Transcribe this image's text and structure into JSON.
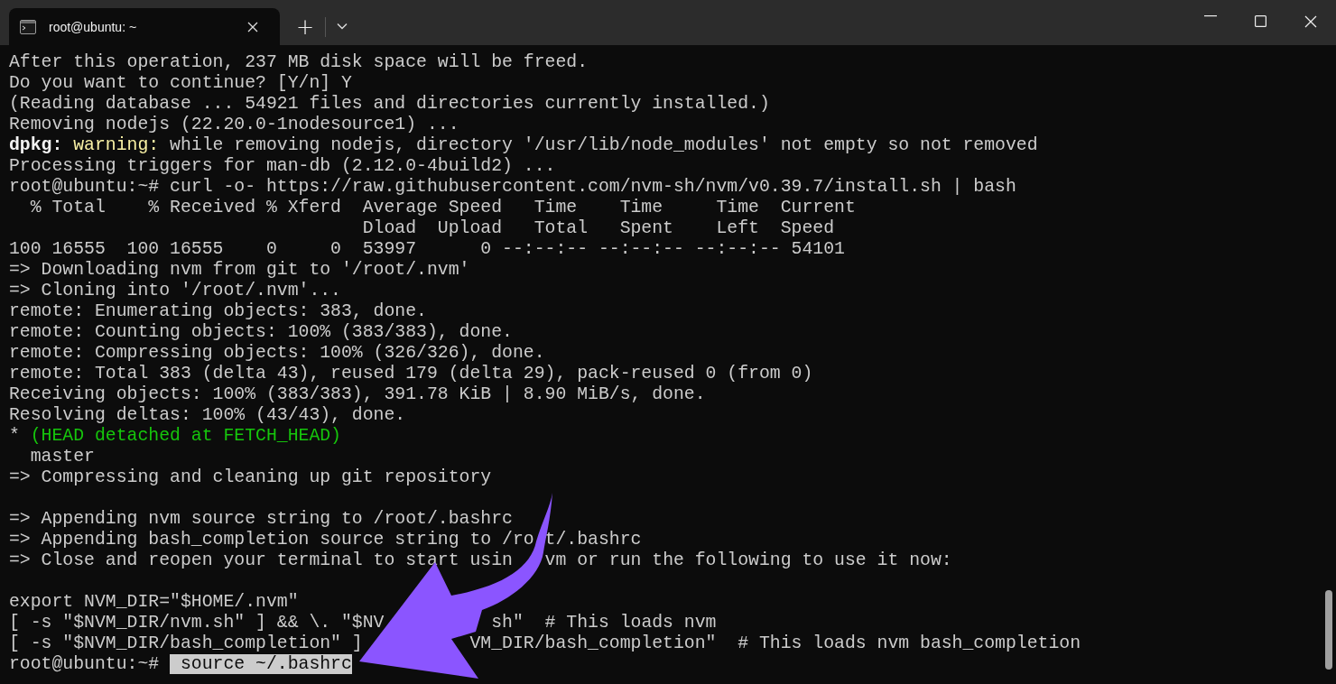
{
  "tab": {
    "title": "root@ubuntu: ~",
    "selected": true
  },
  "new_tab": "+",
  "lines": [
    {
      "kind": "text",
      "segments": [
        {
          "text": "After this operation, 237 MB disk space will be freed.",
          "kind": "plain"
        }
      ]
    },
    {
      "kind": "text",
      "segments": [
        {
          "text": "Do you want to continue? [Y/n] Y",
          "kind": "plain"
        }
      ]
    },
    {
      "kind": "text",
      "segments": [
        {
          "text": "(Reading database ... 54921 files and directories currently installed.)",
          "kind": "plain"
        }
      ]
    },
    {
      "kind": "text",
      "segments": [
        {
          "text": "Removing nodejs (22.20.0-1nodesource1) ...",
          "kind": "plain"
        }
      ]
    },
    {
      "kind": "text",
      "segments": [
        {
          "text": "dpkg:",
          "kind": "bold"
        },
        {
          "text": " warning:",
          "kind": "warning"
        },
        {
          "text": " while removing nodejs, directory '/usr/lib/node_modules' not empty so not removed",
          "kind": "plain"
        }
      ]
    },
    {
      "kind": "text",
      "segments": [
        {
          "text": "Processing triggers for man-db (2.12.0-4build2) ...",
          "kind": "plain"
        }
      ]
    },
    {
      "kind": "text",
      "segments": [
        {
          "text": "root@ubuntu:~# curl -o- https://raw.githubusercontent.com/nvm-sh/nvm/v0.39.7/install.sh | bash",
          "kind": "plain"
        }
      ]
    },
    {
      "kind": "text",
      "segments": [
        {
          "text": "  % Total    % Received % Xferd  Average Speed   Time    Time     Time  Current",
          "kind": "plain"
        }
      ]
    },
    {
      "kind": "text",
      "segments": [
        {
          "text": "                                 Dload  Upload   Total   Spent    Left  Speed",
          "kind": "plain"
        }
      ]
    },
    {
      "kind": "text",
      "segments": [
        {
          "text": "100 16555  100 16555    0     0  53997      0 --:--:-- --:--:-- --:--:-- 54101",
          "kind": "plain"
        }
      ]
    },
    {
      "kind": "text",
      "segments": [
        {
          "text": "=> Downloading nvm from git to '/root/.nvm'",
          "kind": "plain"
        }
      ]
    },
    {
      "kind": "text",
      "segments": [
        {
          "text": "=> Cloning into '/root/.nvm'...",
          "kind": "plain"
        }
      ]
    },
    {
      "kind": "text",
      "segments": [
        {
          "text": "remote: Enumerating objects: 383, done.",
          "kind": "plain"
        }
      ]
    },
    {
      "kind": "text",
      "segments": [
        {
          "text": "remote: Counting objects: 100% (383/383), done.",
          "kind": "plain"
        }
      ]
    },
    {
      "kind": "text",
      "segments": [
        {
          "text": "remote: Compressing objects: 100% (326/326), done.",
          "kind": "plain"
        }
      ]
    },
    {
      "kind": "text",
      "segments": [
        {
          "text": "remote: Total 383 (delta 43), reused 179 (delta 29), pack-reused 0 (from 0)",
          "kind": "plain"
        }
      ]
    },
    {
      "kind": "text",
      "segments": [
        {
          "text": "Receiving objects: 100% (383/383), 391.78 KiB | 8.90 MiB/s, done.",
          "kind": "plain"
        }
      ]
    },
    {
      "kind": "text",
      "segments": [
        {
          "text": "Resolving deltas: 100% (43/43), done.",
          "kind": "plain"
        }
      ]
    },
    {
      "kind": "text",
      "segments": [
        {
          "text": "*",
          "kind": "plain"
        },
        {
          "text": " (HEAD detached at FETCH_HEAD)",
          "kind": "green"
        }
      ]
    },
    {
      "kind": "text",
      "segments": [
        {
          "text": "  master",
          "kind": "plain"
        }
      ]
    },
    {
      "kind": "text",
      "segments": [
        {
          "text": "=> Compressing and cleaning up git repository",
          "kind": "plain"
        }
      ]
    },
    {
      "kind": "blank"
    },
    {
      "kind": "text",
      "segments": [
        {
          "text": "=> Appending nvm source string to /root/.bashrc",
          "kind": "plain"
        }
      ]
    },
    {
      "kind": "text",
      "segments": [
        {
          "text": "=> Appending bash_completion source string to /ro",
          "kind": "plain"
        },
        {
          "text": " t/.bashrc",
          "kind": "plain"
        }
      ]
    },
    {
      "kind": "text",
      "segments": [
        {
          "text": "=> Close and reopen your terminal to start usin",
          "kind": "plain"
        },
        {
          "text": "   vm or run the following to use it now:",
          "kind": "plain"
        }
      ]
    },
    {
      "kind": "blank"
    },
    {
      "kind": "text",
      "segments": [
        {
          "text": "export NVM_DIR=\"$HOME/.nvm\"",
          "kind": "plain"
        }
      ]
    },
    {
      "kind": "text",
      "segments": [
        {
          "text": "[ -s \"$NVM_DIR/nvm.sh\" ] && \\. \"$NV",
          "kind": "plain"
        },
        {
          "text": "          sh\"  # This loads nvm",
          "kind": "plain"
        }
      ]
    },
    {
      "kind": "text",
      "segments": [
        {
          "text": "[ -s \"$NVM_DIR/bash_completion\" ]",
          "kind": "plain"
        },
        {
          "text": "          VM_DIR/bash_completion\"  # This loads nvm bash_completion",
          "kind": "plain"
        }
      ]
    },
    {
      "kind": "text",
      "segments": [
        {
          "text": "root@ubuntu:~# ",
          "kind": "plain"
        },
        {
          "text": " source ~/.bashrc",
          "kind": "selected"
        }
      ]
    }
  ]
}
